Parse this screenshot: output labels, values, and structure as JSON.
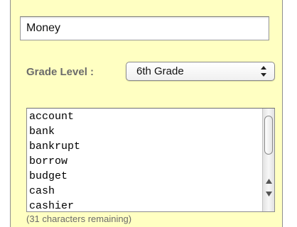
{
  "title_field": {
    "value": "Money"
  },
  "grade_level": {
    "label": "Grade Level :",
    "selected": "6th Grade"
  },
  "word_list": {
    "items": [
      "account",
      "bank",
      "bankrupt",
      "borrow",
      "budget",
      "cash",
      "cashier"
    ]
  },
  "remaining_text": "(31 characters remaining)",
  "icons": {
    "select_arrows": "up-down-arrows-icon",
    "scroll_up": "triangle-up-icon",
    "scroll_down": "triangle-down-icon"
  },
  "colors": {
    "panel_background": "#ffffc2",
    "label_text": "#6b6b6b"
  }
}
